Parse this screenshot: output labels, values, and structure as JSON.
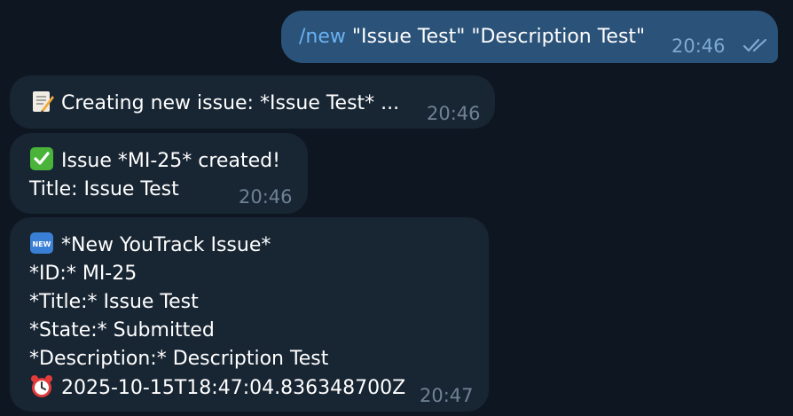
{
  "messages": {
    "command": {
      "command": "/new",
      "args": " \"Issue Test\" \"Description Test\"",
      "time": "20:46"
    },
    "creating": {
      "emoji": "memo-icon",
      "text": "Creating new issue: *Issue Test* ...",
      "time": "20:46"
    },
    "created": {
      "emoji": "check-mark-icon",
      "line1": "Issue *MI-25* created!",
      "line2": "Title: Issue Test",
      "time": "20:46"
    },
    "notification": {
      "emoji_top": "new-badge-icon",
      "line1": "*New YouTrack Issue*",
      "line2": "*ID:* MI-25",
      "line3": "*Title:* Issue Test",
      "line4": "*State:* Submitted",
      "line5": "*Description:* Description Test",
      "emoji_bottom": "alarm-clock-icon",
      "line6": "2025-10-15T18:47:04.836348700Z",
      "time": "20:47"
    }
  },
  "colors": {
    "background": "#0e1621",
    "outgoing_bubble": "#2b5278",
    "incoming_bubble": "#182533",
    "command": "#6ab2f2",
    "time": "#6f8295"
  }
}
